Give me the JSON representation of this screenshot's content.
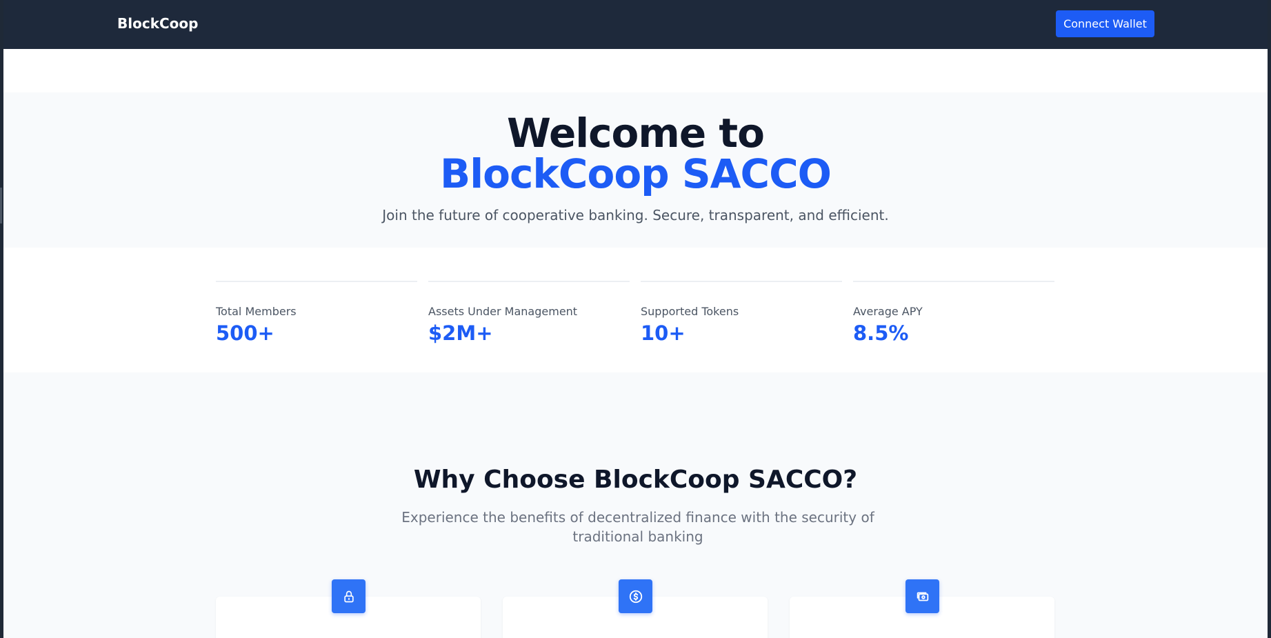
{
  "navbar": {
    "brand": "BlockCoop",
    "connect_label": "Connect Wallet"
  },
  "hero": {
    "title_line1": "Welcome to",
    "title_line2": "BlockCoop SACCO",
    "subtitle": "Join the future of cooperative banking. Secure, transparent, and efficient."
  },
  "stats": [
    {
      "label": "Total Members",
      "value": "500+"
    },
    {
      "label": "Assets Under Management",
      "value": "$2M+"
    },
    {
      "label": "Supported Tokens",
      "value": "10+"
    },
    {
      "label": "Average APY",
      "value": "8.5%"
    }
  ],
  "features": {
    "title": "Why Choose BlockCoop SACCO?",
    "subtitle": "Experience the benefits of decentralized finance with the security of traditional banking",
    "cards": [
      {
        "icon": "lock-icon"
      },
      {
        "icon": "dollar-circle-icon"
      },
      {
        "icon": "cash-icon"
      }
    ]
  },
  "colors": {
    "navbar_bg": "#1e293b",
    "accent": "#1d5cf5",
    "heading": "#0f172a",
    "muted": "#4b5563",
    "section_bg": "#f8fafc"
  }
}
